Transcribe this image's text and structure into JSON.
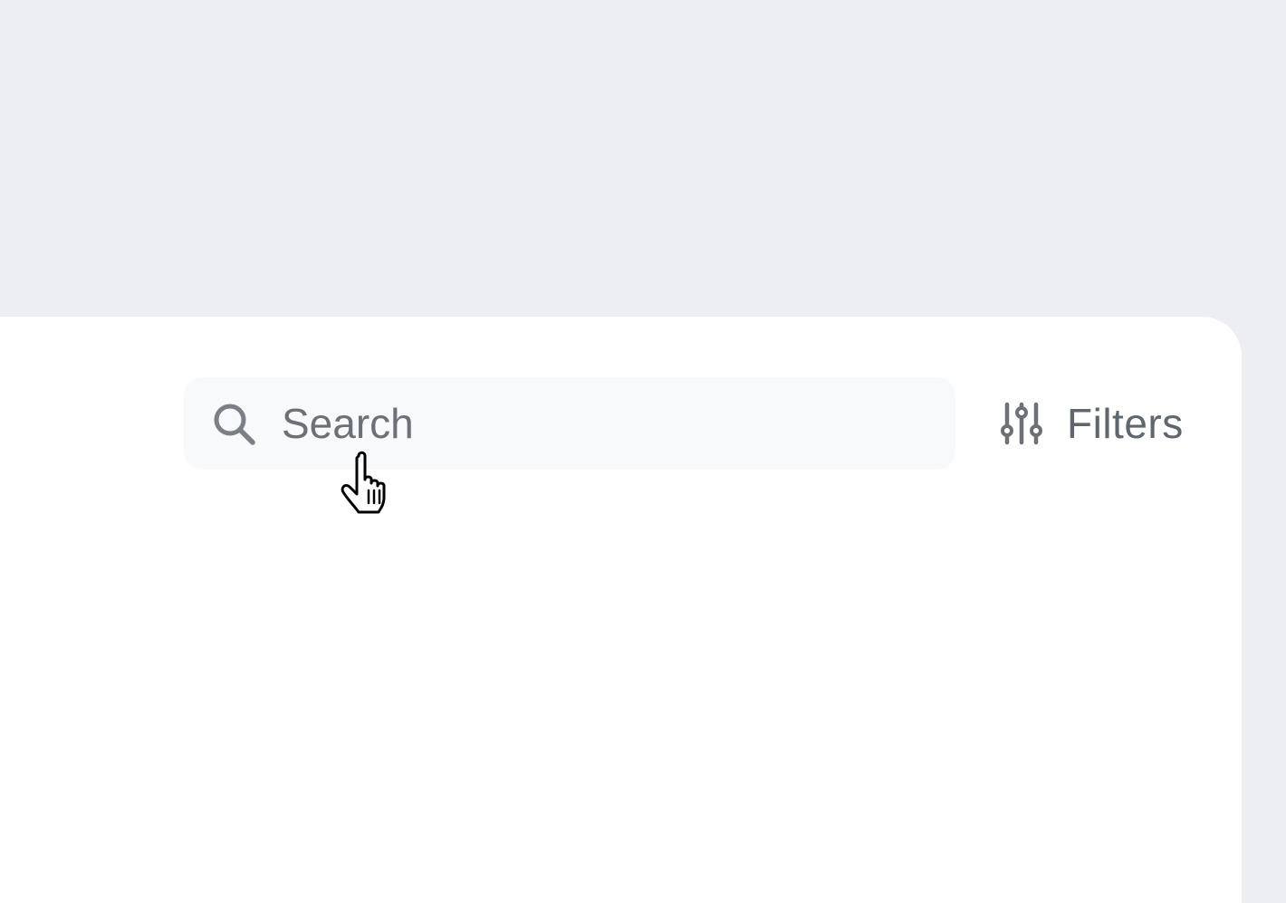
{
  "search": {
    "placeholder": "Search",
    "value": "",
    "icon": "search-icon"
  },
  "filters": {
    "label": "Filters",
    "icon": "sliders-icon"
  },
  "cursor": {
    "type": "pointer-hand"
  },
  "colors": {
    "background": "#edeef2",
    "panel": "#ffffff",
    "search_field": "#f8f9fa",
    "icon": "#6b7177",
    "text_muted": "#5f666d"
  }
}
